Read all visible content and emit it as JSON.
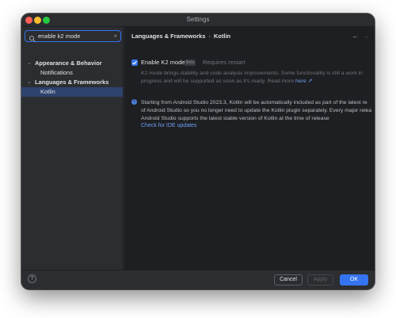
{
  "window": {
    "title": "Settings"
  },
  "search": {
    "value": "enable k2 mode",
    "clear_glyph": "×"
  },
  "sidebar": {
    "items": [
      {
        "label": "Appearance & Behavior",
        "expanded": true
      },
      {
        "label": "Notifications"
      },
      {
        "label": "Languages & Frameworks",
        "expanded": true
      },
      {
        "label": "Kotlin",
        "selected": true
      }
    ]
  },
  "main": {
    "breadcrumb": [
      "Languages & Frameworks",
      "Kotlin"
    ],
    "k2": {
      "checkbox_label": "Enable K2 mode",
      "checked": true,
      "badge": "Beta",
      "hint": "Requires restart",
      "description": "K2 mode brings stability and code analysis improvements. Some functionality is still a work in progress and will be supported as soon as it's ready. Read more",
      "link": "here ↗"
    },
    "info": {
      "lines": [
        "Starting from Android Studio 2023.3, Kotlin will be automatically included as part of the latest re",
        "of Android Studio so you no longer need to update the Kotlin plugin separately. Every major relea",
        "Android Studio supports the latest stable version of Kotlin at the time of release"
      ],
      "link": "Check for IDE updates"
    }
  },
  "footer": {
    "help": "?",
    "cancel": "Cancel",
    "apply": "Apply",
    "ok": "OK"
  },
  "colors": {
    "accent": "#3574f0",
    "link": "#6e9ff6",
    "background": "#1e1f22",
    "panel": "#2b2d30"
  }
}
